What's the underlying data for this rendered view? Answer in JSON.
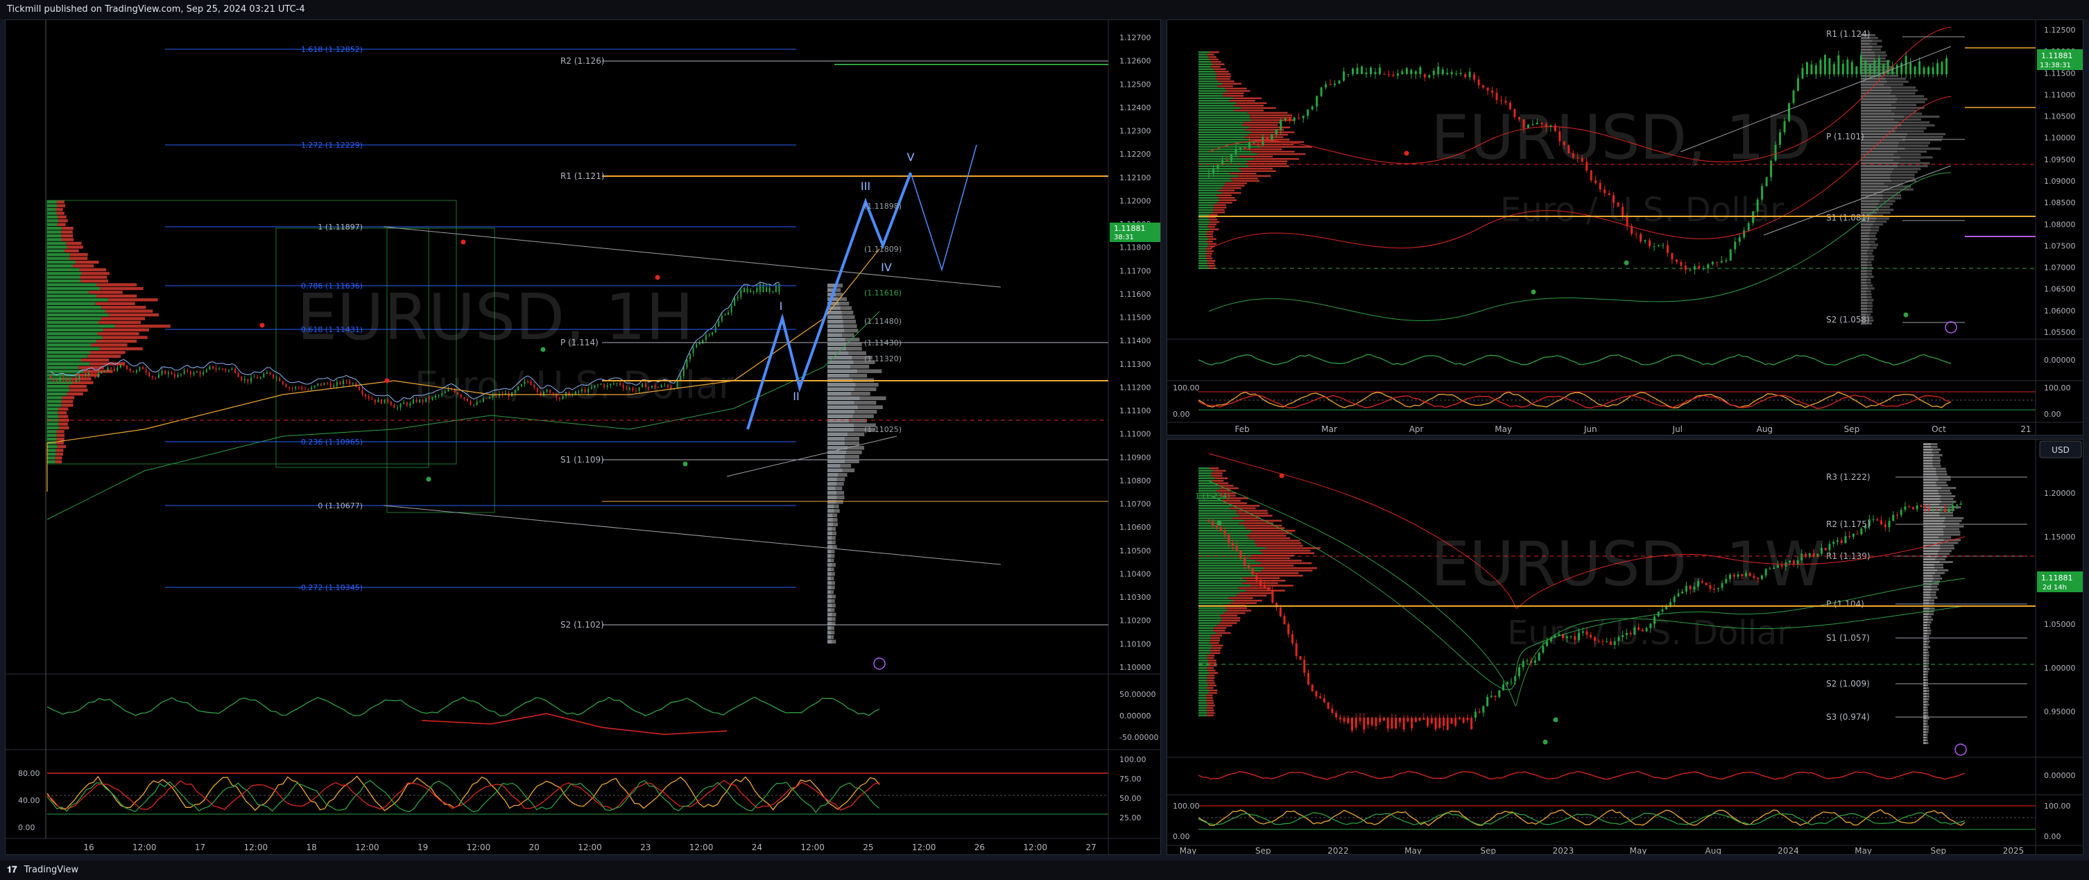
{
  "header": {
    "publisher": "Tickmill published on TradingView.com, Sep 25, 2024 03:21 UTC-4"
  },
  "footer": {
    "brand": "TradingView"
  },
  "colors": {
    "up": "#26a641",
    "down": "#e0261f",
    "accent": "#2962ff",
    "pivot": "#f0a830",
    "bg": "#000000"
  },
  "left_chart": {
    "watermark_symbol": "EURUSD, 1H",
    "watermark_desc": "Euro / U.S. Dollar",
    "price_axis": [
      "1.12700",
      "1.12600",
      "1.12500",
      "1.12400",
      "1.12300",
      "1.12200",
      "1.12100",
      "1.12000",
      "1.11900",
      "1.11800",
      "1.11700",
      "1.11600",
      "1.11500",
      "1.11400",
      "1.11300",
      "1.11200",
      "1.11100",
      "1.11000",
      "1.10900",
      "1.10800",
      "1.10700",
      "1.10600",
      "1.10500",
      "1.10400",
      "1.10300",
      "1.10200",
      "1.10100",
      "1.10000"
    ],
    "current_price": "1.11881",
    "countdown": "38:31",
    "fib_labels": [
      "1.618 (1.12852)",
      "1.272 (1.12229)",
      "1 (1.11897)",
      "0.786 (1.11636)",
      "0.618 (1.11431)",
      "0.236 (1.10965)",
      "0 (1.10677)",
      "-0.272 (1.10345)"
    ],
    "pivot_labels": [
      "R2 (1.126)",
      "R1 (1.121)",
      "P (1.114)",
      "S1 (1.109)",
      "S2 (1.102)"
    ],
    "wave_labels": [
      "I",
      "II",
      "III",
      "IV",
      "V"
    ],
    "target_labels": [
      "(1.11898)",
      "(1.11809)",
      "(1.11616)",
      "(1.11480)",
      "(1.11430)",
      "(1.11320)",
      "(1.11025)"
    ],
    "osc1_axis": [
      "50.00000",
      "0.00000",
      "-50.00000"
    ],
    "osc2_axis": [
      "100.00",
      "75.00",
      "50.00",
      "25.00"
    ],
    "osc2_left": [
      "80.00",
      "40.00",
      "0.00"
    ],
    "time_axis": [
      "16",
      "12:00",
      "17",
      "12:00",
      "18",
      "12:00",
      "19",
      "12:00",
      "20",
      "12:00",
      "23",
      "12:00",
      "24",
      "12:00",
      "25",
      "12:00",
      "26",
      "12:00",
      "27"
    ]
  },
  "top_right_chart": {
    "watermark_symbol": "EURUSD, 1D",
    "watermark_desc": "Euro / U.S. Dollar",
    "price_axis": [
      "1.12500",
      "1.12000",
      "1.11500",
      "1.11000",
      "1.10500",
      "1.10000",
      "1.09500",
      "1.09000",
      "1.08500",
      "1.08000",
      "1.07500",
      "1.07000",
      "1.06500",
      "1.06000",
      "1.05500"
    ],
    "current_price": "1.11881",
    "countdown": "13:38:31",
    "pivot_labels": [
      "R1 (1.124)",
      "P (1.101)",
      "S1 (1.081)",
      "S2 (1.058)"
    ],
    "osc1_axis": [
      "0.00000"
    ],
    "osc2_left": [
      "100.00",
      "0.00"
    ],
    "osc2_axis": [
      "100.00",
      "0.00"
    ],
    "time_axis": [
      "Feb",
      "Mar",
      "Apr",
      "May",
      "Jun",
      "Jul",
      "Aug",
      "Sep",
      "Oct",
      "21"
    ]
  },
  "bottom_right_chart": {
    "watermark_symbol": "EURUSD, 1W",
    "watermark_desc": "Euro / U.S. Dollar",
    "currency_button": "USD",
    "price_axis": [
      "1.20000",
      "1.15000",
      "1.10000",
      "1.05000",
      "1.00000",
      "0.95000"
    ],
    "current_price": "1.11881",
    "countdown": "2d 14h",
    "pivot_labels": [
      "R3 (1.222)",
      "R2 (1.175)",
      "R1 (1.139)",
      "P (1.104)",
      "S1 (1.057)",
      "S2 (1.009)",
      "S3 (0.974)"
    ],
    "fib_label": "1 (1.234)",
    "osc1_axis": [
      "0.00000"
    ],
    "osc2_left": [
      "100.00",
      "0.00"
    ],
    "osc2_axis": [
      "100.00",
      "0.00"
    ],
    "time_axis": [
      "May",
      "Sep",
      "2022",
      "May",
      "Sep",
      "2023",
      "May",
      "Aug",
      "2024",
      "May",
      "Sep",
      "2025"
    ]
  }
}
